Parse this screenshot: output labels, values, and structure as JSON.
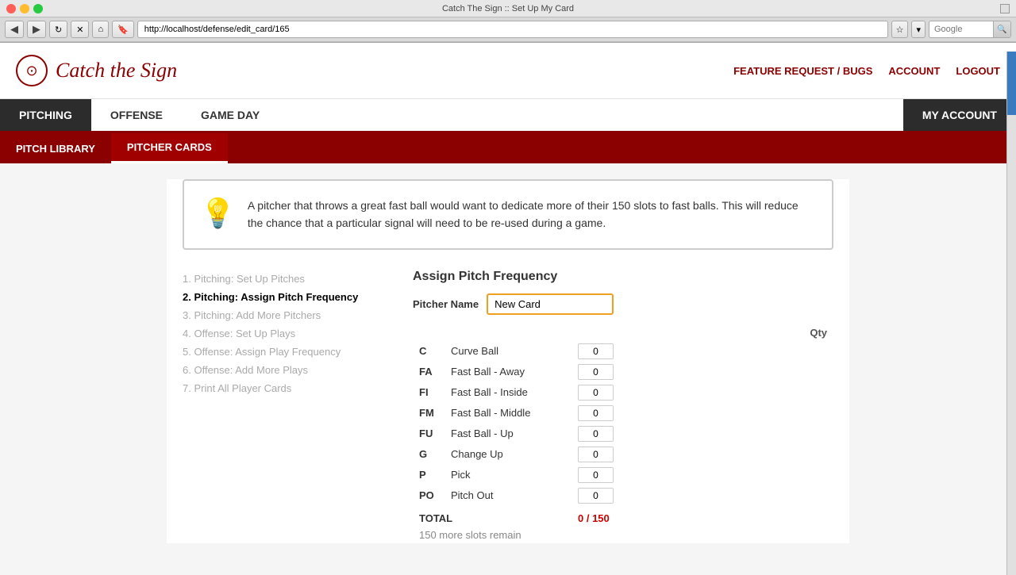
{
  "browser": {
    "title": "Catch The Sign :: Set Up My Card",
    "url": "http://localhost/defense/edit_card/165",
    "search_placeholder": "Google",
    "back": "◀",
    "forward": "▶",
    "reload": "↻",
    "stop": "✕",
    "home": "⌂"
  },
  "header": {
    "logo_icon": "⊙",
    "logo_text": "Catch the Sign",
    "nav_links": [
      {
        "label": "FEATURE REQUEST / BUGS",
        "key": "feature-request"
      },
      {
        "label": "ACCOUNT",
        "key": "account"
      },
      {
        "label": "LOGOUT",
        "key": "logout"
      }
    ]
  },
  "main_nav": {
    "items": [
      {
        "label": "PITCHING",
        "active": true
      },
      {
        "label": "OFFENSE",
        "active": false
      },
      {
        "label": "GAME DAY",
        "active": false
      }
    ],
    "right_item": "MY ACCOUNT"
  },
  "sub_nav": {
    "items": [
      {
        "label": "PITCH LIBRARY",
        "active": false
      },
      {
        "label": "PITCHER CARDS",
        "active": true
      }
    ]
  },
  "tip": {
    "icon": "💡",
    "text": "A pitcher that throws a great fast ball would want to dedicate more of their 150 slots to fast balls. This will reduce the chance that a particular signal will need to be re-used during a game."
  },
  "steps": [
    {
      "num": "1.",
      "label": "Pitching: Set Up Pitches",
      "active": false
    },
    {
      "num": "2.",
      "label": "Pitching: Assign Pitch Frequency",
      "active": true
    },
    {
      "num": "3.",
      "label": "Pitching: Add More Pitchers",
      "active": false
    },
    {
      "num": "4.",
      "label": "Offense: Set Up Plays",
      "active": false
    },
    {
      "num": "5.",
      "label": "Offense: Assign Play Frequency",
      "active": false
    },
    {
      "num": "6.",
      "label": "Offense: Add More Plays",
      "active": false
    },
    {
      "num": "7.",
      "label": "Print All Player Cards",
      "active": false
    }
  ],
  "form": {
    "title": "Assign Pitch Frequency",
    "pitcher_name_label": "Pitcher Name",
    "pitcher_name_value": "New Card",
    "qty_header": "Qty",
    "pitches": [
      {
        "code": "C",
        "name": "Curve Ball",
        "qty": "0"
      },
      {
        "code": "FA",
        "name": "Fast Ball - Away",
        "qty": "0"
      },
      {
        "code": "FI",
        "name": "Fast Ball - Inside",
        "qty": "0"
      },
      {
        "code": "FM",
        "name": "Fast Ball - Middle",
        "qty": "0"
      },
      {
        "code": "FU",
        "name": "Fast Ball - Up",
        "qty": "0"
      },
      {
        "code": "G",
        "name": "Change Up",
        "qty": "0"
      },
      {
        "code": "P",
        "name": "Pick",
        "qty": "0"
      },
      {
        "code": "PO",
        "name": "Pitch Out",
        "qty": "0"
      }
    ],
    "total_label": "TOTAL",
    "total_value": "0 / 150",
    "slots_remain": "150 more slots remain"
  }
}
